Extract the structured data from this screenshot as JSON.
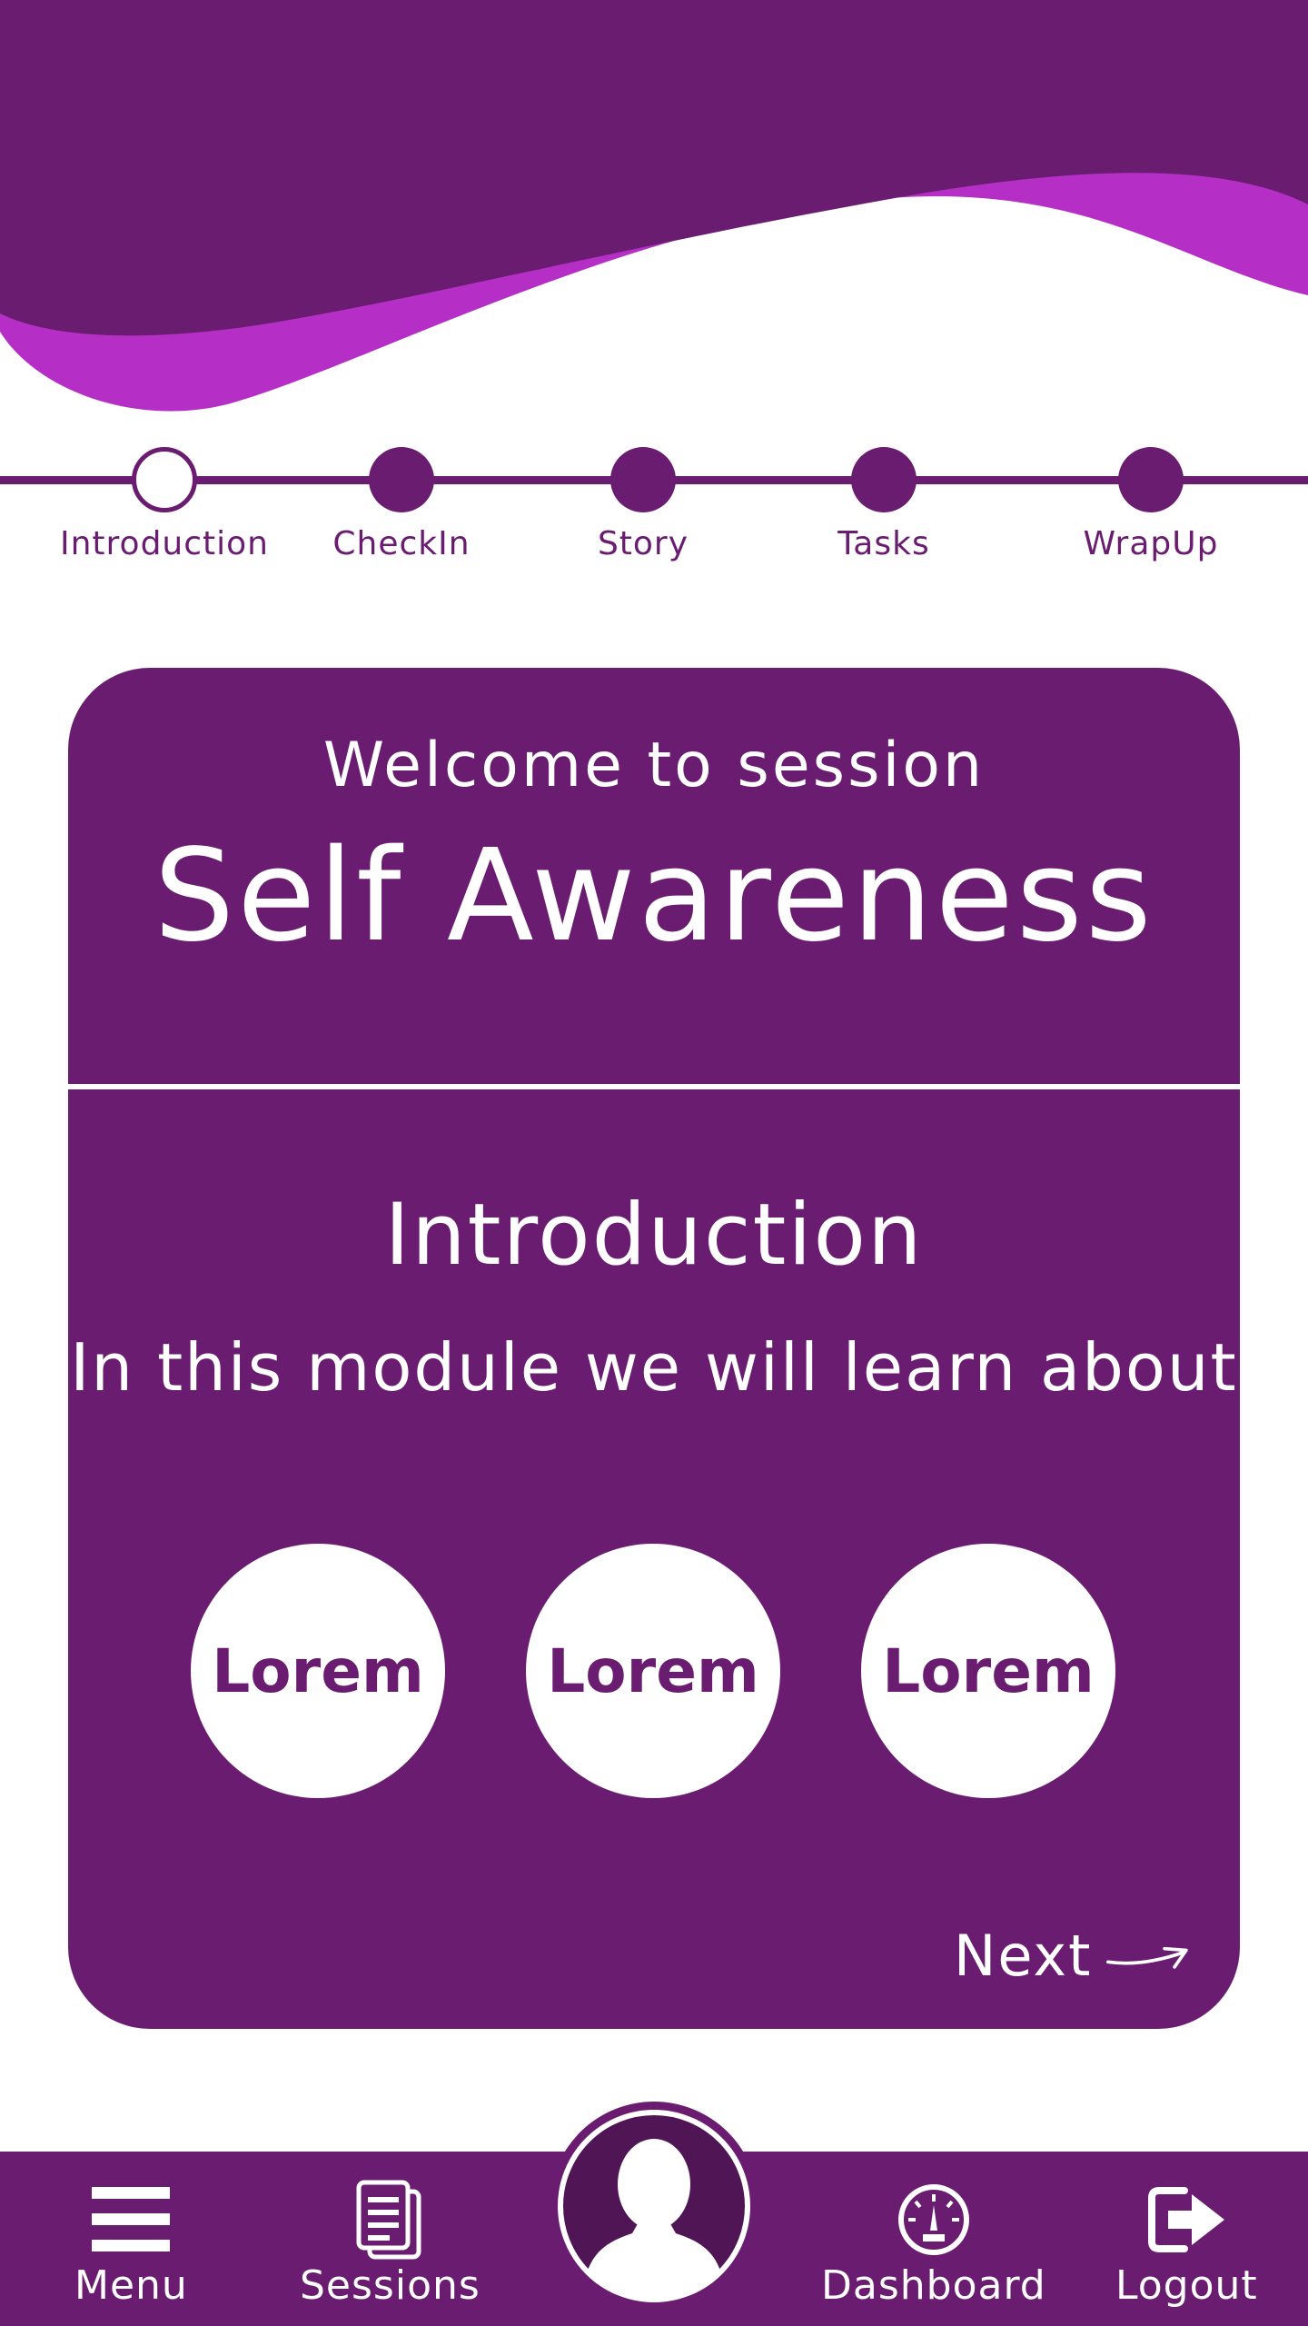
{
  "theme": {
    "primary": "#6a1c70",
    "accent": "#b52fc6",
    "avatar_dark": "#4f1555",
    "background": "#ffffff"
  },
  "progress": {
    "steps": [
      {
        "label": "Introduction",
        "state": "current"
      },
      {
        "label": "CheckIn",
        "state": "upcoming"
      },
      {
        "label": "Story",
        "state": "upcoming"
      },
      {
        "label": "Tasks",
        "state": "upcoming"
      },
      {
        "label": "WrapUp",
        "state": "upcoming"
      }
    ]
  },
  "card": {
    "welcome": "Welcome to session",
    "session_title": "Self Awareness",
    "section_title": "Introduction",
    "section_text": "In this module we will learn about",
    "topics": [
      "Lorem",
      "Lorem",
      "Lorem"
    ],
    "next_label": "Next",
    "next_icon": "arrow-right-icon"
  },
  "bottom_nav": {
    "menu": {
      "label": "Menu",
      "icon": "hamburger-menu-icon"
    },
    "sessions": {
      "label": "Sessions",
      "icon": "document-icon"
    },
    "profile": {
      "icon": "user-avatar-icon"
    },
    "dashboard": {
      "label": "Dashboard",
      "icon": "gauge-icon"
    },
    "logout": {
      "label": "Logout",
      "icon": "logout-icon"
    }
  }
}
